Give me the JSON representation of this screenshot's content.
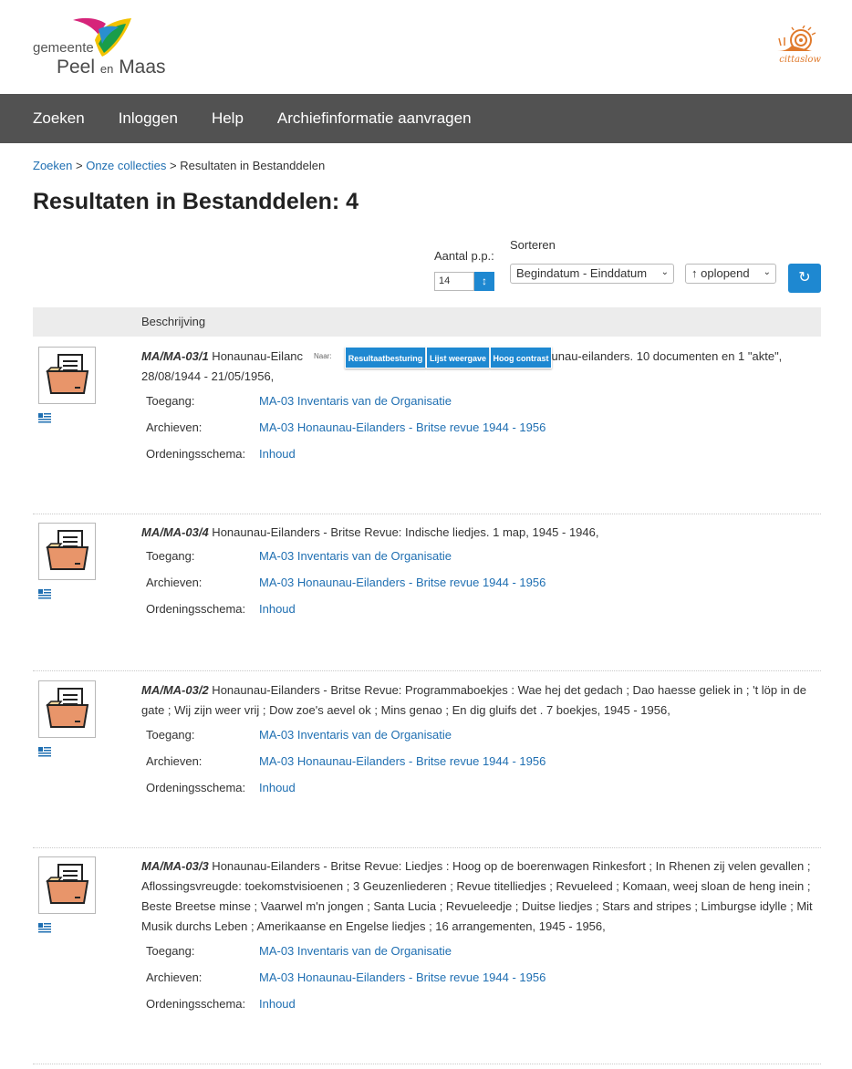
{
  "header": {
    "logo_top": "gemeente",
    "logo_name": "Peel",
    "logo_en": "en",
    "logo_name2": "Maas",
    "cittaslow": "cittaslow"
  },
  "nav": {
    "items": [
      "Zoeken",
      "Inloggen",
      "Help",
      "Archiefinformatie aanvragen"
    ]
  },
  "breadcrumb": {
    "link1": "Zoeken",
    "sep1": ">",
    "link2": "Onze collecties",
    "sep2": ">",
    "current": "Resultaten in Bestanddelen"
  },
  "page_title": "Resultaten in Bestanddelen: 4",
  "controls": {
    "per_page_label": "Aantal p.p.:",
    "per_page_value": "14",
    "sort_label": "Sorteren",
    "sort_field": "Begindatum - Einddatum",
    "sort_order": "↑ oplopend"
  },
  "table": {
    "header": "Beschrijving"
  },
  "overlay": {
    "label": "Naar:",
    "buttons": [
      "Resultaatbesturing",
      "Lijst weergave",
      "Hoog contrast"
    ]
  },
  "field_labels": {
    "toegang": "Toegang:",
    "archieven": "Archieven:",
    "ordening": "Ordeningsschema:"
  },
  "results": [
    {
      "code": "MA/MA-03/1",
      "text_before": " Honaunau-Eilanc",
      "text_after": "naunau-eilanders. 10 documenten en 1 \"akte\",",
      "line2": "28/08/1944 - 21/05/1956,",
      "toegang": "MA-03 Inventaris van de Organisatie",
      "archieven": "MA-03 Honaunau-Eilanders - Britse revue 1944 - 1956",
      "ordening": "Inhoud"
    },
    {
      "code": "MA/MA-03/4",
      "text": " Honaunau-Eilanders - Britse Revue: Indische liedjes. 1 map, 1945 - 1946,",
      "toegang": "MA-03 Inventaris van de Organisatie",
      "archieven": "MA-03 Honaunau-Eilanders - Britse revue 1944 - 1956",
      "ordening": "Inhoud"
    },
    {
      "code": "MA/MA-03/2",
      "text": " Honaunau-Eilanders - Britse Revue: Programmaboekjes : Wae hej det gedach ; Dao haesse geliek in ; 't löp in de gate ; Wij zijn weer vrij ; Dow zoe's aevel ok ; Mins genao ; En dig gluifs det . 7 boekjes, 1945 - 1956,",
      "toegang": "MA-03 Inventaris van de Organisatie",
      "archieven": "MA-03 Honaunau-Eilanders - Britse revue 1944 - 1956",
      "ordening": "Inhoud"
    },
    {
      "code": "MA/MA-03/3",
      "text": " Honaunau-Eilanders - Britse Revue: Liedjes : Hoog op de boerenwagen Rinkesfort ; In Rhenen zij velen gevallen ; Aflossingsvreugde: toekomstvisioenen ; 3 Geuzenliederen ; Revue titelliedjes ; Revueleed ; Komaan, weej sloan de heng inein ; Beste Breetse minse ; Vaarwel m'n jongen ; Santa Lucia ; Revueleedje ; Duitse liedjes ; Stars and stripes ; Limburgse idylle ; Mit Musik durchs Leben ; Amerikaanse en Engelse liedjes ; 16 arrangementen, 1945 - 1956,",
      "toegang": "MA-03 Inventaris van de Organisatie",
      "archieven": "MA-03 Honaunau-Eilanders - Britse revue 1944 - 1956",
      "ordening": "Inhoud"
    }
  ],
  "colors": {
    "nav_bg": "#525252",
    "link": "#1f6fb2",
    "accent_button": "#1e88d1",
    "folder": "#e8956a"
  }
}
